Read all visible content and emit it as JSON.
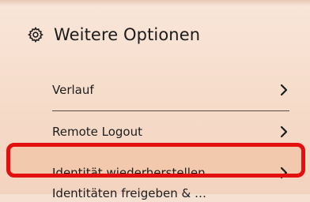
{
  "section": {
    "title": "Weitere Optionen",
    "icon": "gear-icon"
  },
  "menu": {
    "items": [
      {
        "label": "Verlauf",
        "icon": "chevron-right-icon"
      },
      {
        "label": "Remote Logout",
        "icon": "chevron-right-icon"
      },
      {
        "label": "Identität wiederherstellen",
        "icon": "chevron-right-icon",
        "highlighted": true
      }
    ],
    "partial_item": {
      "label": "Identitäten freigeben & …"
    }
  },
  "colors": {
    "background": "#f6e0d2",
    "highlight_border": "#e31010",
    "highlight_fill": "#f3c9ad",
    "divider": "#5a4c45"
  }
}
